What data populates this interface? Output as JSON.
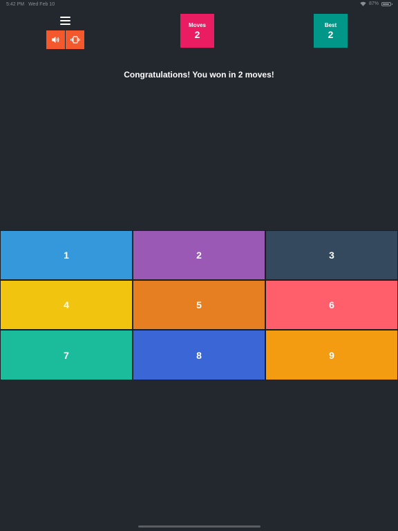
{
  "status_bar": {
    "time": "5:42 PM",
    "date": "Wed Feb 10",
    "battery_text": "87%",
    "battery_level": 0.87
  },
  "menu": {
    "icon": "hamburger-menu-icon"
  },
  "toggles": {
    "sound_icon": "speaker-icon",
    "vibrate_icon": "vibrate-icon",
    "color": "#f4592d"
  },
  "scores": {
    "moves_label": "Moves",
    "moves_value": "2",
    "moves_color": "#ea1d63",
    "best_label": "Best",
    "best_value": "2",
    "best_color": "#009688"
  },
  "message": "Congratulations! You won in 2 moves!",
  "tiles": [
    {
      "label": "1",
      "color": "#3498db"
    },
    {
      "label": "2",
      "color": "#9b59b6"
    },
    {
      "label": "3",
      "color": "#34495e"
    },
    {
      "label": "4",
      "color": "#f1c40f"
    },
    {
      "label": "5",
      "color": "#e67e22"
    },
    {
      "label": "6",
      "color": "#ff5e6a"
    },
    {
      "label": "7",
      "color": "#1abc9c"
    },
    {
      "label": "8",
      "color": "#3b67d6"
    },
    {
      "label": "9",
      "color": "#f39c12"
    }
  ],
  "background_color": "#23272e"
}
